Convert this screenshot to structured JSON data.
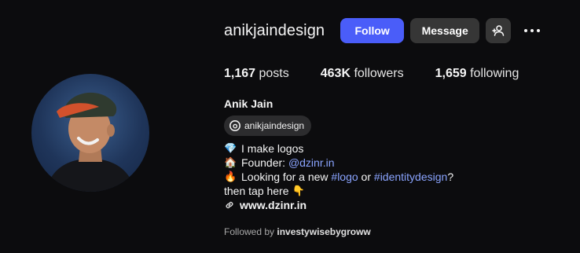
{
  "profile": {
    "username": "anikjaindesign",
    "full_name": "Anik Jain",
    "threads_handle": "anikjaindesign",
    "buttons": {
      "follow": "Follow",
      "message": "Message"
    },
    "stats": {
      "posts_count": "1,167",
      "posts_label": "posts",
      "followers_count": "463K",
      "followers_label": "followers",
      "following_count": "1,659",
      "following_label": "following"
    },
    "bio": {
      "line1_emoji": "💎",
      "line1_text": "I make logos",
      "line2_emoji": "🏠",
      "line2_prefix": "Founder: ",
      "line2_link": "@dzinr.in",
      "line3_emoji": "🔥",
      "line3_prefix": "Looking for a new ",
      "line3_tag1": "#logo",
      "line3_mid": " or ",
      "line3_tag2": "#identitydesign",
      "line3_suffix": "?",
      "line4_text": "then tap here",
      "line4_emoji": "👇",
      "website": "www.dzinr.in"
    },
    "followed_by": {
      "prefix": "Followed by",
      "user": "investywisebygroww"
    }
  },
  "colors": {
    "background": "#0c0c0e",
    "follow_button": "#4a5df9",
    "secondary_button": "#363636",
    "link": "#8aa4ff"
  },
  "icons": [
    "add-user-icon",
    "more-options-icon",
    "threads-icon",
    "link-icon"
  ]
}
